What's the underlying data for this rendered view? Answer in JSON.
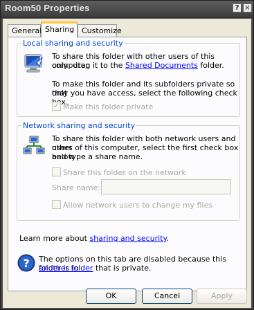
{
  "window": {
    "title": "Room50 Properties",
    "help_glyph": "?",
    "close_glyph": "×"
  },
  "tabs": [
    {
      "label": "General"
    },
    {
      "label": "Sharing"
    },
    {
      "label": "Customize"
    }
  ],
  "local": {
    "legend": "Local sharing and security",
    "line1": "To share this folder with other users of this computer",
    "line2_pre": "only, drag it to the ",
    "line2_link": "Shared Documents",
    "line2_post": " folder.",
    "line3": "To make this folder and its subfolders private so that",
    "line4": "only you have access, select the following check box.",
    "private_label": "Make this folder private",
    "private_checked": true
  },
  "network": {
    "legend": "Network sharing and security",
    "line1": "To share this folder with both network users and other",
    "line2": "users of this computer, select the first check box below",
    "line3": "and type a share name.",
    "share_label": "Share this folder on the network",
    "share_name_label": "Share name:",
    "share_name_value": "",
    "allow_label": "Allow network users to change my files",
    "learn_pre": "Learn more about ",
    "learn_link": "sharing and security",
    "learn_post": "."
  },
  "info": {
    "line1": "The options on this tab are disabled because this folder is in",
    "line2_link": "another folder",
    "line2_post": " that is private."
  },
  "buttons": {
    "ok": "OK",
    "cancel": "Cancel",
    "apply": "Apply"
  },
  "colors": {
    "accent_blue": "#0046d5",
    "link": "#0000ff",
    "tab_highlight": "#ffc83c",
    "disabled_text": "#aca899"
  }
}
